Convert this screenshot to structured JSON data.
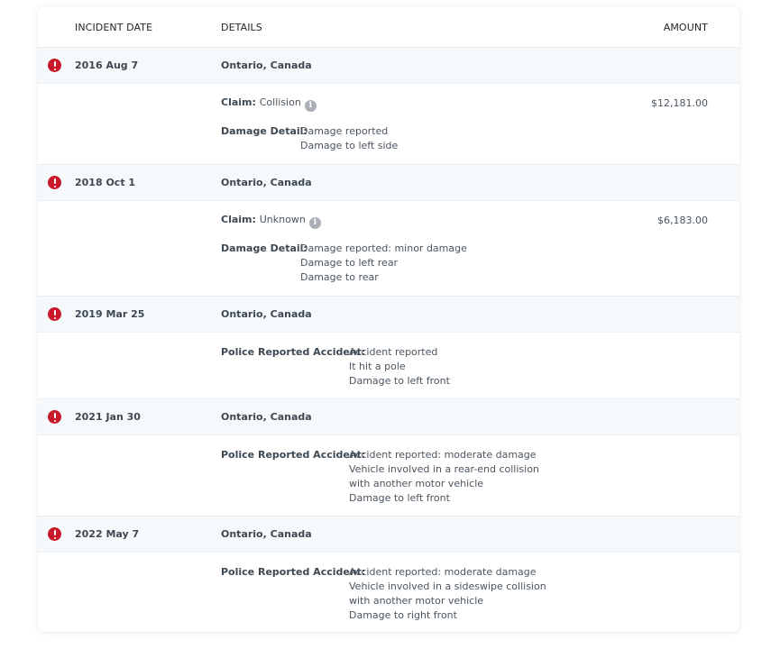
{
  "header": {
    "incident_date": "INCIDENT DATE",
    "details": "DETAILS",
    "amount": "AMOUNT"
  },
  "incidents": [
    {
      "date": "2016 Aug 7",
      "location": "Ontario, Canada",
      "claim_label": "Claim:",
      "claim_value": "Collision",
      "amount": "$12,181.00",
      "detail_label": "Damage Detail:",
      "details": [
        "Damage reported",
        "Damage to left side"
      ]
    },
    {
      "date": "2018 Oct 1",
      "location": "Ontario, Canada",
      "claim_label": "Claim:",
      "claim_value": "Unknown",
      "amount": "$6,183.00",
      "detail_label": "Damage Detail:",
      "details": [
        "Damage reported: minor damage",
        "Damage to left rear",
        "Damage to rear"
      ]
    },
    {
      "date": "2019 Mar 25",
      "location": "Ontario, Canada",
      "detail_label": "Police Reported Accident:",
      "details": [
        "Accident reported",
        "It hit a pole",
        "Damage to left front"
      ]
    },
    {
      "date": "2021 Jan 30",
      "location": "Ontario, Canada",
      "detail_label": "Police Reported Accident:",
      "details": [
        "Accident reported: moderate damage",
        "Vehicle involved in a rear-end collision",
        "with another motor vehicle",
        "Damage to left front"
      ]
    },
    {
      "date": "2022 May 7",
      "location": "Ontario, Canada",
      "detail_label": "Police Reported Accident:",
      "details": [
        "Accident reported: moderate damage",
        "Vehicle involved in a sideswipe collision",
        "with another motor vehicle",
        "Damage to right front"
      ]
    }
  ],
  "icons": {
    "alert": "alert-circle-icon",
    "info": "info-icon"
  },
  "colors": {
    "alert": "#c91a2b",
    "row_bg": "#f6f9fc",
    "info": "#a9b0b7"
  }
}
